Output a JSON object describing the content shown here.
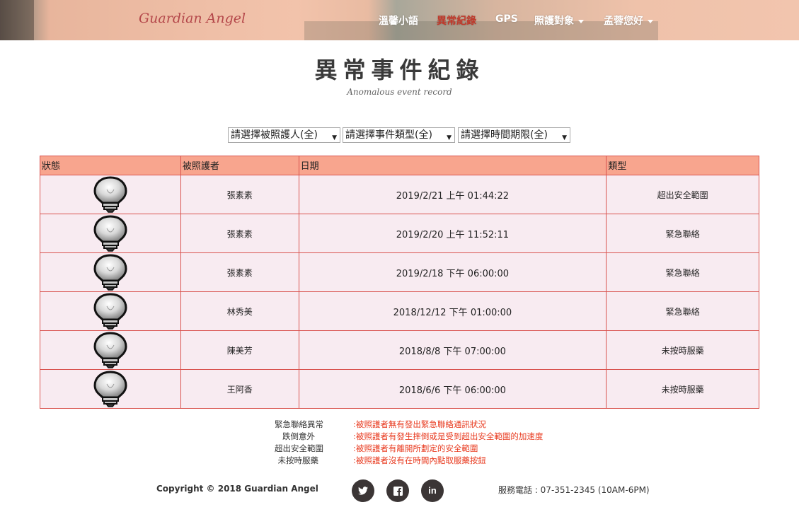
{
  "brand": "Guardian Angel",
  "nav": {
    "items": [
      {
        "label": "溫馨小語"
      },
      {
        "label": "異常紀錄"
      },
      {
        "label": "GPS"
      },
      {
        "label": "照護對象"
      },
      {
        "label": "孟蓉您好"
      }
    ]
  },
  "page": {
    "title": "異常事件紀錄",
    "subtitle": "Anomalous event record"
  },
  "filters": {
    "person": "請選擇被照護人(全)",
    "event_type": "請選擇事件類型(全)",
    "time_range": "請選擇時間期限(全)"
  },
  "table": {
    "headers": [
      "狀態",
      "被照護者",
      "日期",
      "類型"
    ],
    "rows": [
      {
        "name": "張素素",
        "date": "2019/2/21 上午 01:44:22",
        "type": "超出安全範圍"
      },
      {
        "name": "張素素",
        "date": "2019/2/20 上午 11:52:11",
        "type": "緊急聯絡"
      },
      {
        "name": "張素素",
        "date": "2019/2/18 下午 06:00:00",
        "type": "緊急聯絡"
      },
      {
        "name": "林秀美",
        "date": "2018/12/12 下午 01:00:00",
        "type": "緊急聯絡"
      },
      {
        "name": "陳美芳",
        "date": "2018/8/8 下午 07:00:00",
        "type": "未按時服藥"
      },
      {
        "name": "王阿香",
        "date": "2018/6/6 下午 06:00:00",
        "type": "未按時服藥"
      }
    ]
  },
  "legend": [
    {
      "term": "緊急聯絡異常",
      "desc": ":被照護者無有發出緊急聯絡通訊狀況"
    },
    {
      "term": "跌倒意外",
      "desc": ":被照護者有發生摔倒或是受到超出安全範圍的加速度"
    },
    {
      "term": "超出安全範圍",
      "desc": ":被照護者有離開所劃定的安全範圍"
    },
    {
      "term": "未按時服藥",
      "desc": ":被照護者沒有在時間內點取服藥按鈕"
    }
  ],
  "footer": {
    "copyright": "Copyright © 2018 Guardian Angel",
    "phone": "服務電話 : 07-351-2345 (10AM-6PM)",
    "social": [
      {
        "icon": "twitter-icon",
        "glyph": "🐦"
      },
      {
        "icon": "facebook-icon",
        "glyph": "f"
      },
      {
        "icon": "linkedin-icon",
        "glyph": "in"
      }
    ]
  },
  "colors": {
    "accent": "#c0392b",
    "table_header": "#f8a58e",
    "table_row": "#f8ebf1",
    "table_border": "#d9534f",
    "legend_desc": "#e8391e",
    "brand": "#b4474a"
  }
}
